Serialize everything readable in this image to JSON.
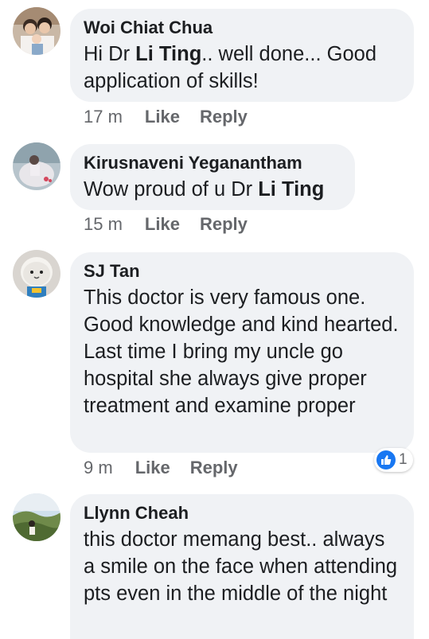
{
  "comments": [
    {
      "author": "Woi Chiat Chua",
      "text_parts": [
        "Hi Dr ",
        "Li Ting",
        ".. well done... Good application of skills!"
      ],
      "time": "17 m",
      "like_label": "Like",
      "reply_label": "Reply"
    },
    {
      "author": "Kirusnaveni Yeganantham",
      "text_parts": [
        "Wow proud of u Dr ",
        "Li Ting"
      ],
      "time": "15 m",
      "like_label": "Like",
      "reply_label": "Reply"
    },
    {
      "author": "SJ Tan",
      "text": "This doctor is very famous one. Good knowledge and kind hearted. Last time I bring my uncle go hospital she always give proper treatment and examine proper",
      "time": "9 m",
      "like_label": "Like",
      "reply_label": "Reply",
      "reaction": {
        "icon": "like-thumb-icon",
        "count": "1",
        "color": "#1877f2"
      }
    },
    {
      "author": "Llynn Cheah",
      "text": "this doctor memang best.. always a smile on the face when attending pts even in the middle of the night"
    }
  ],
  "colors": {
    "bubble": "#f0f2f5",
    "text": "#1c1e21",
    "meta": "#65676b",
    "accent": "#1877f2"
  }
}
